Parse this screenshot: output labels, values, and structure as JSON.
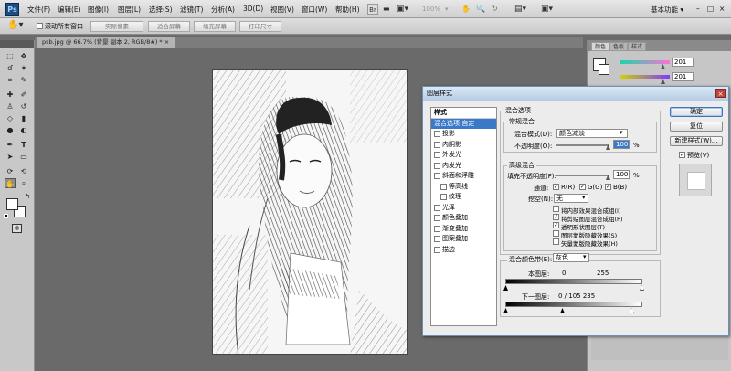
{
  "app": {
    "logo": "Ps"
  },
  "menubar": {
    "items": [
      "文件(F)",
      "编辑(E)",
      "图像(I)",
      "图层(L)",
      "选择(S)",
      "滤镜(T)",
      "分析(A)",
      "3D(D)",
      "视图(V)",
      "窗口(W)",
      "帮助(H)"
    ],
    "zoom": "100%",
    "workspace": "基本功能 ▾",
    "win_min": "–",
    "win_max": "□",
    "win_close": "×"
  },
  "optionsbar": {
    "scroll_all": "滚动所有窗口",
    "buttons": [
      "实际像素",
      "适合屏幕",
      "填充屏幕",
      "打印尺寸"
    ]
  },
  "document": {
    "tab": "psb.jpg @ 66.7% (背景 副本 2, RGB/8#) * ×"
  },
  "panel": {
    "tabs": [
      "颜色",
      "色板",
      "样式"
    ],
    "value1": "201",
    "value2": "201"
  },
  "dialog": {
    "title": "图层样式",
    "close": "×",
    "styles_header": "样式",
    "styles": [
      {
        "label": "混合选项:自定",
        "checkbox": false,
        "selected": true
      },
      {
        "label": "投影",
        "checkbox": true
      },
      {
        "label": "内阴影",
        "checkbox": true
      },
      {
        "label": "外发光",
        "checkbox": true
      },
      {
        "label": "内发光",
        "checkbox": true
      },
      {
        "label": "斜面和浮雕",
        "checkbox": true
      },
      {
        "label": "等高线",
        "checkbox": true,
        "indent": true
      },
      {
        "label": "纹理",
        "checkbox": true,
        "indent": true
      },
      {
        "label": "光泽",
        "checkbox": true
      },
      {
        "label": "颜色叠加",
        "checkbox": true
      },
      {
        "label": "渐变叠加",
        "checkbox": true
      },
      {
        "label": "图案叠加",
        "checkbox": true
      },
      {
        "label": "描边",
        "checkbox": true
      }
    ],
    "blend_options": "混合选项",
    "general": "常规混合",
    "blend_mode_label": "混合模式(D):",
    "blend_mode": "颜色减淡",
    "opacity_label": "不透明度(O):",
    "opacity": "100",
    "pct": "%",
    "advanced": "高级混合",
    "fill_label": "填充不透明度(F):",
    "fill": "100",
    "channels_label": "通道:",
    "ch_r": "R(R)",
    "ch_g": "G(G)",
    "ch_b": "B(B)",
    "knockout_label": "挖空(N):",
    "knockout": "无",
    "adv_checks": [
      {
        "label": "将内部效果混合成组(I)",
        "checked": false
      },
      {
        "label": "将剪贴图层混合成组(P)",
        "checked": true
      },
      {
        "label": "透明形状图层(T)",
        "checked": true
      },
      {
        "label": "图层蒙版隐藏效果(S)",
        "checked": false
      },
      {
        "label": "矢量蒙版隐藏效果(H)",
        "checked": false
      }
    ],
    "blend_if_label": "混合颜色带(E):",
    "blend_if": "灰色",
    "this_layer_label": "本图层:",
    "this_layer_low": "0",
    "this_layer_high": "255",
    "under_layer_label": "下一图层:",
    "under_layer_values": "0  /  105   235",
    "ok": "确定",
    "reset": "复位",
    "new_style": "新建样式(W)...",
    "preview": "预览(V)"
  }
}
